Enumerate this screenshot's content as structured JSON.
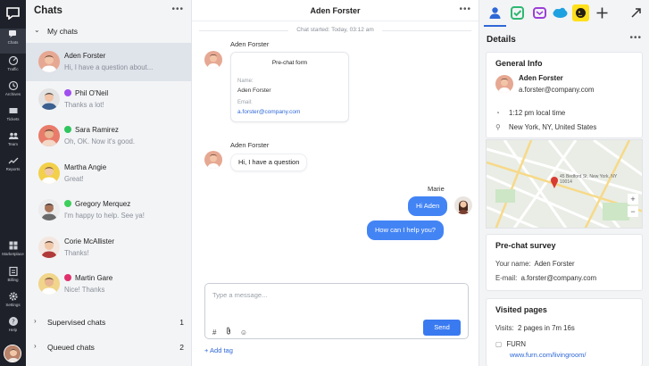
{
  "sidebar": {
    "items": [
      {
        "label": "Chats",
        "icon": "chat-bubbles-icon"
      },
      {
        "label": "Traffic",
        "icon": "radar-icon"
      },
      {
        "label": "Archives",
        "icon": "clock-icon"
      },
      {
        "label": "Tickets",
        "icon": "ticket-icon"
      },
      {
        "label": "Team",
        "icon": "team-icon"
      },
      {
        "label": "Reports",
        "icon": "chart-icon"
      },
      {
        "label": "Marketplace",
        "icon": "grid-icon"
      },
      {
        "label": "Billing",
        "icon": "billing-icon"
      },
      {
        "label": "Settings",
        "icon": "gear-icon"
      },
      {
        "label": "Help",
        "icon": "help-icon"
      }
    ]
  },
  "chat_list": {
    "title": "Chats",
    "more": "•••",
    "my_chats_label": "My chats",
    "chats": [
      {
        "name": "Aden Forster",
        "preview": "Hi, I have a question about...",
        "channel": "",
        "selected": true
      },
      {
        "name": "Phil O'Neil",
        "preview": "Thanks a lot!",
        "channel": "messenger"
      },
      {
        "name": "Sara Ramirez",
        "preview": "Oh, OK. Now it's good.",
        "channel": "whatsapp"
      },
      {
        "name": "Martha Angie",
        "preview": "Great!",
        "channel": ""
      },
      {
        "name": "Gregory Merquez",
        "preview": "I'm happy to help. See ya!",
        "channel": "imessage"
      },
      {
        "name": "Corie McAllister",
        "preview": "Thanks!",
        "channel": ""
      },
      {
        "name": "Martin Gare",
        "preview": "Nice! Thanks",
        "channel": "instagram"
      }
    ],
    "supervised": {
      "label": "Supervised chats",
      "count": "1"
    },
    "queued": {
      "label": "Queued chats",
      "count": "2"
    }
  },
  "conversation": {
    "title": "Aden Forster",
    "more": "•••",
    "system_note": "Chat started: Today, 03:12 am",
    "sender_customer": "Aden Forster",
    "form": {
      "title": "Pre-chat form",
      "name_label": "Name:",
      "name_value": "Aden Forster",
      "email_label": "Email:",
      "email_value": "a.forster@company.com"
    },
    "customer_message": "Hi, I have a question",
    "agent_name": "Marie",
    "agent_messages": [
      "Hi Aden",
      "How can I help you?"
    ],
    "composer_placeholder": "Type a message...",
    "send_label": "Send",
    "add_tag_label": "+ Add tag",
    "tool_hash": "#",
    "tool_attach": "⊘",
    "tool_emoji": "☺"
  },
  "details": {
    "title": "Details",
    "more": "•••",
    "general_info": {
      "heading": "General Info",
      "name": "Aden Forster",
      "email": "a.forster@company.com",
      "local_time": "1:12 pm local time",
      "location": "New York, NY, United States"
    },
    "map_address": "45 Bedford St, New York, NY 10014",
    "map_zoom_in": "+",
    "map_zoom_out": "−",
    "survey": {
      "heading": "Pre-chat survey",
      "name_label": "Your name:",
      "name_value": "Aden Forster",
      "email_label": "E-mail:",
      "email_value": "a.forster@company.com"
    },
    "visited": {
      "heading": "Visited pages",
      "visits_label": "Visits:",
      "visits_value": "2 pages in 7m 16s",
      "page_title": "FURN",
      "page_url": "www.furn.com/livingroom/"
    }
  },
  "colors": {
    "accent": "#3a7af0",
    "rail": "#1e2129",
    "list_bg": "#f3f4f6"
  }
}
